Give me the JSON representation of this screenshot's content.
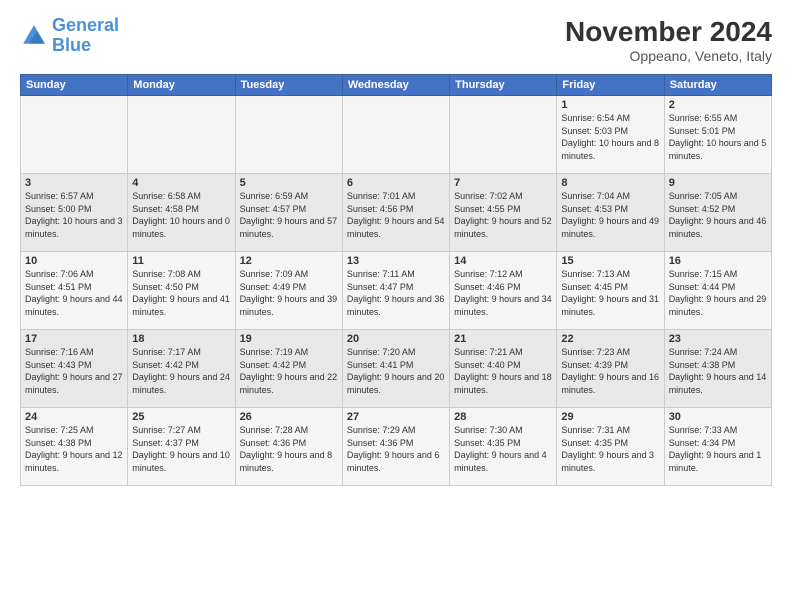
{
  "logo": {
    "text_general": "General",
    "text_blue": "Blue"
  },
  "header": {
    "title": "November 2024",
    "subtitle": "Oppeano, Veneto, Italy"
  },
  "days_of_week": [
    "Sunday",
    "Monday",
    "Tuesday",
    "Wednesday",
    "Thursday",
    "Friday",
    "Saturday"
  ],
  "weeks": [
    [
      {
        "day": "",
        "info": ""
      },
      {
        "day": "",
        "info": ""
      },
      {
        "day": "",
        "info": ""
      },
      {
        "day": "",
        "info": ""
      },
      {
        "day": "",
        "info": ""
      },
      {
        "day": "1",
        "info": "Sunrise: 6:54 AM\nSunset: 5:03 PM\nDaylight: 10 hours and 8 minutes."
      },
      {
        "day": "2",
        "info": "Sunrise: 6:55 AM\nSunset: 5:01 PM\nDaylight: 10 hours and 5 minutes."
      }
    ],
    [
      {
        "day": "3",
        "info": "Sunrise: 6:57 AM\nSunset: 5:00 PM\nDaylight: 10 hours and 3 minutes."
      },
      {
        "day": "4",
        "info": "Sunrise: 6:58 AM\nSunset: 4:58 PM\nDaylight: 10 hours and 0 minutes."
      },
      {
        "day": "5",
        "info": "Sunrise: 6:59 AM\nSunset: 4:57 PM\nDaylight: 9 hours and 57 minutes."
      },
      {
        "day": "6",
        "info": "Sunrise: 7:01 AM\nSunset: 4:56 PM\nDaylight: 9 hours and 54 minutes."
      },
      {
        "day": "7",
        "info": "Sunrise: 7:02 AM\nSunset: 4:55 PM\nDaylight: 9 hours and 52 minutes."
      },
      {
        "day": "8",
        "info": "Sunrise: 7:04 AM\nSunset: 4:53 PM\nDaylight: 9 hours and 49 minutes."
      },
      {
        "day": "9",
        "info": "Sunrise: 7:05 AM\nSunset: 4:52 PM\nDaylight: 9 hours and 46 minutes."
      }
    ],
    [
      {
        "day": "10",
        "info": "Sunrise: 7:06 AM\nSunset: 4:51 PM\nDaylight: 9 hours and 44 minutes."
      },
      {
        "day": "11",
        "info": "Sunrise: 7:08 AM\nSunset: 4:50 PM\nDaylight: 9 hours and 41 minutes."
      },
      {
        "day": "12",
        "info": "Sunrise: 7:09 AM\nSunset: 4:49 PM\nDaylight: 9 hours and 39 minutes."
      },
      {
        "day": "13",
        "info": "Sunrise: 7:11 AM\nSunset: 4:47 PM\nDaylight: 9 hours and 36 minutes."
      },
      {
        "day": "14",
        "info": "Sunrise: 7:12 AM\nSunset: 4:46 PM\nDaylight: 9 hours and 34 minutes."
      },
      {
        "day": "15",
        "info": "Sunrise: 7:13 AM\nSunset: 4:45 PM\nDaylight: 9 hours and 31 minutes."
      },
      {
        "day": "16",
        "info": "Sunrise: 7:15 AM\nSunset: 4:44 PM\nDaylight: 9 hours and 29 minutes."
      }
    ],
    [
      {
        "day": "17",
        "info": "Sunrise: 7:16 AM\nSunset: 4:43 PM\nDaylight: 9 hours and 27 minutes."
      },
      {
        "day": "18",
        "info": "Sunrise: 7:17 AM\nSunset: 4:42 PM\nDaylight: 9 hours and 24 minutes."
      },
      {
        "day": "19",
        "info": "Sunrise: 7:19 AM\nSunset: 4:42 PM\nDaylight: 9 hours and 22 minutes."
      },
      {
        "day": "20",
        "info": "Sunrise: 7:20 AM\nSunset: 4:41 PM\nDaylight: 9 hours and 20 minutes."
      },
      {
        "day": "21",
        "info": "Sunrise: 7:21 AM\nSunset: 4:40 PM\nDaylight: 9 hours and 18 minutes."
      },
      {
        "day": "22",
        "info": "Sunrise: 7:23 AM\nSunset: 4:39 PM\nDaylight: 9 hours and 16 minutes."
      },
      {
        "day": "23",
        "info": "Sunrise: 7:24 AM\nSunset: 4:38 PM\nDaylight: 9 hours and 14 minutes."
      }
    ],
    [
      {
        "day": "24",
        "info": "Sunrise: 7:25 AM\nSunset: 4:38 PM\nDaylight: 9 hours and 12 minutes."
      },
      {
        "day": "25",
        "info": "Sunrise: 7:27 AM\nSunset: 4:37 PM\nDaylight: 9 hours and 10 minutes."
      },
      {
        "day": "26",
        "info": "Sunrise: 7:28 AM\nSunset: 4:36 PM\nDaylight: 9 hours and 8 minutes."
      },
      {
        "day": "27",
        "info": "Sunrise: 7:29 AM\nSunset: 4:36 PM\nDaylight: 9 hours and 6 minutes."
      },
      {
        "day": "28",
        "info": "Sunrise: 7:30 AM\nSunset: 4:35 PM\nDaylight: 9 hours and 4 minutes."
      },
      {
        "day": "29",
        "info": "Sunrise: 7:31 AM\nSunset: 4:35 PM\nDaylight: 9 hours and 3 minutes."
      },
      {
        "day": "30",
        "info": "Sunrise: 7:33 AM\nSunset: 4:34 PM\nDaylight: 9 hours and 1 minute."
      }
    ]
  ]
}
